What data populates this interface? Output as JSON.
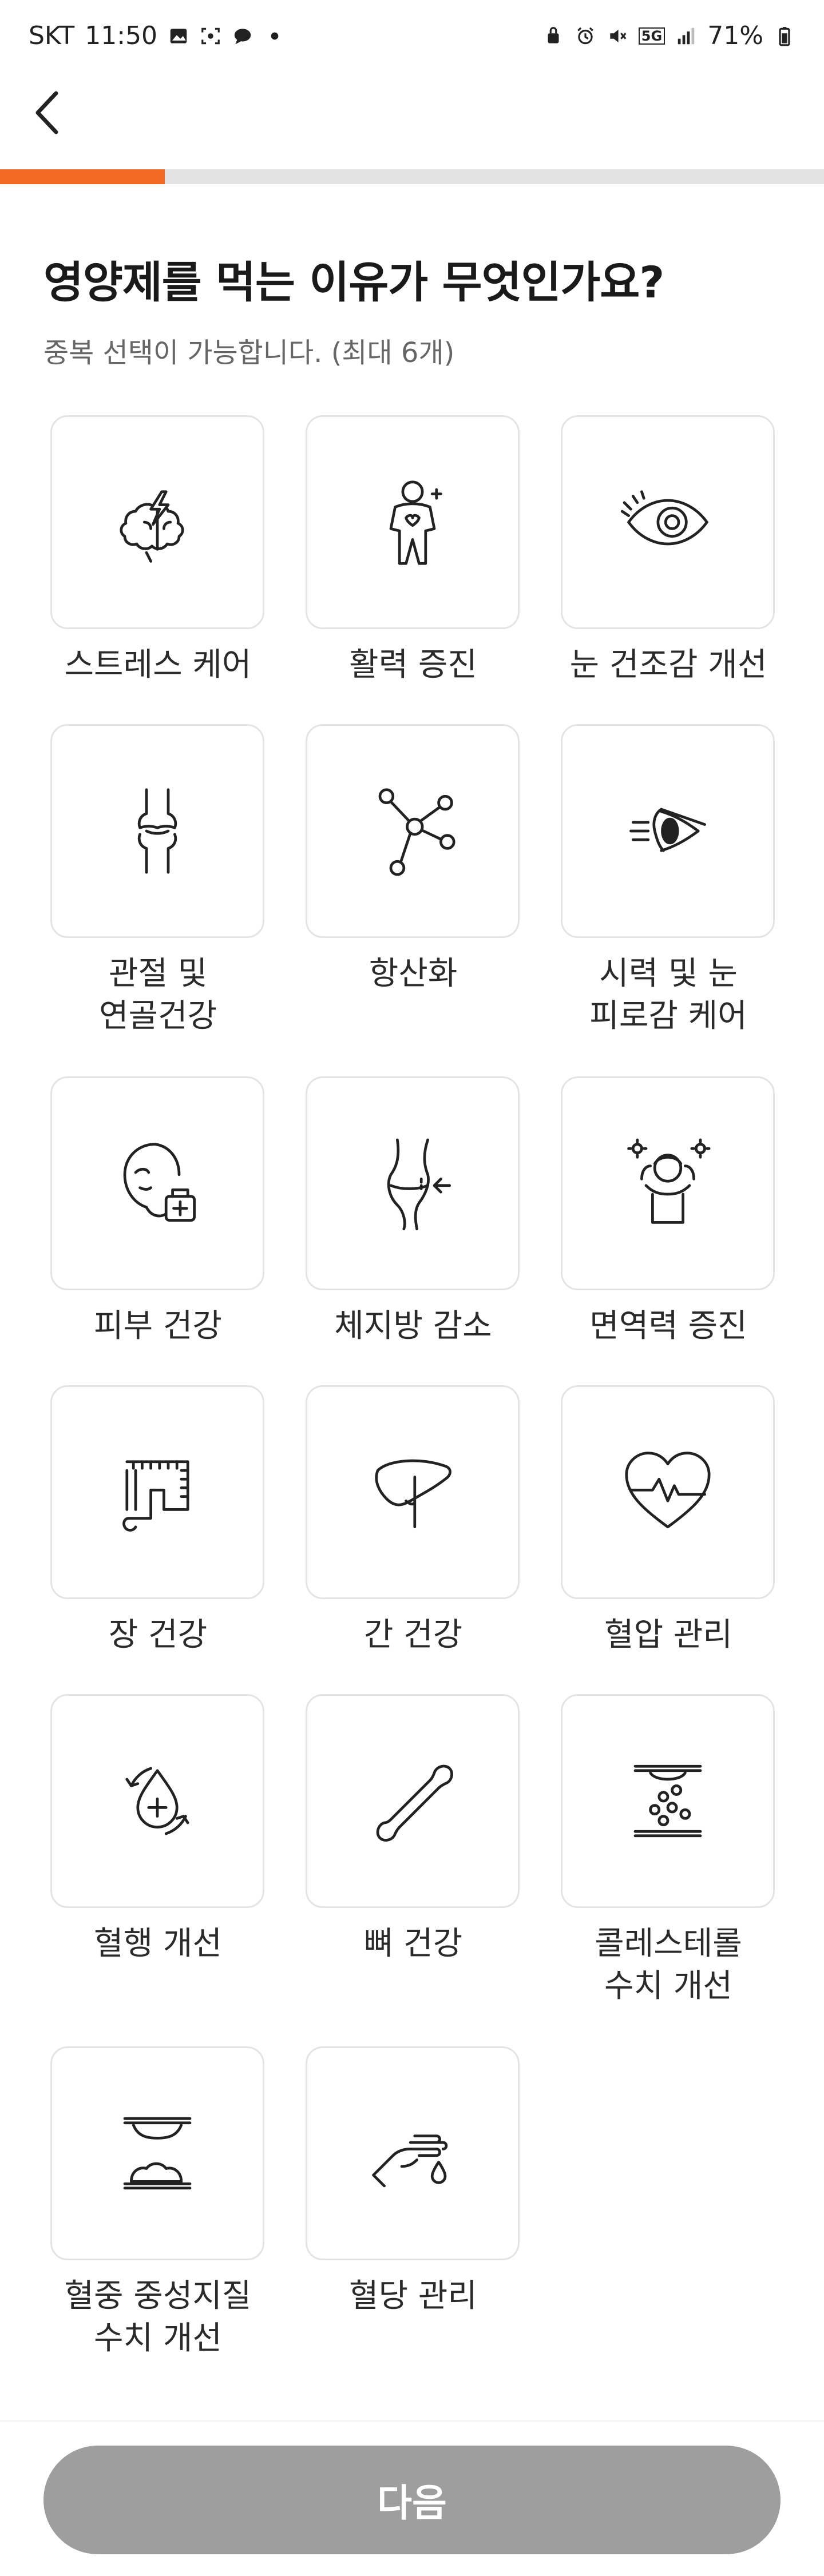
{
  "status_bar": {
    "carrier": "SKT",
    "time": "11:50",
    "battery": "71%",
    "network": "5G"
  },
  "progress": {
    "value": 0.2
  },
  "question": {
    "title": "영양제를 먹는 이유가 무엇인가요?",
    "subtitle": "중복 선택이 가능합니다. (최대 6개)"
  },
  "options": [
    {
      "label": "스트레스 케어",
      "icon": "stress-brain-icon"
    },
    {
      "label": "활력 증진",
      "icon": "vitality-person-icon"
    },
    {
      "label": "눈 건조감 개선",
      "icon": "eye-icon"
    },
    {
      "label": "관절 및\n연골건강",
      "icon": "joint-icon"
    },
    {
      "label": "항산화",
      "icon": "molecule-icon"
    },
    {
      "label": "시력 및 눈\n피로감 케어",
      "icon": "eye-side-icon"
    },
    {
      "label": "피부 건강",
      "icon": "skin-care-icon"
    },
    {
      "label": "체지방 감소",
      "icon": "waist-icon"
    },
    {
      "label": "면역력 증진",
      "icon": "immunity-person-icon"
    },
    {
      "label": "장 건강",
      "icon": "intestine-icon"
    },
    {
      "label": "간 건강",
      "icon": "liver-icon"
    },
    {
      "label": "혈압 관리",
      "icon": "heart-pulse-icon"
    },
    {
      "label": "혈행 개선",
      "icon": "blood-circulation-icon"
    },
    {
      "label": "뼈 건강",
      "icon": "bone-icon"
    },
    {
      "label": "콜레스테롤\n수치 개선",
      "icon": "cholesterol-icon"
    },
    {
      "label": "혈중 중성지질\n수치 개선",
      "icon": "triglyceride-icon"
    },
    {
      "label": "혈당 관리",
      "icon": "blood-sugar-icon"
    }
  ],
  "next_button": {
    "label": "다음"
  },
  "colors": {
    "accent": "#f26a21",
    "button_disabled": "#9e9e9e"
  }
}
